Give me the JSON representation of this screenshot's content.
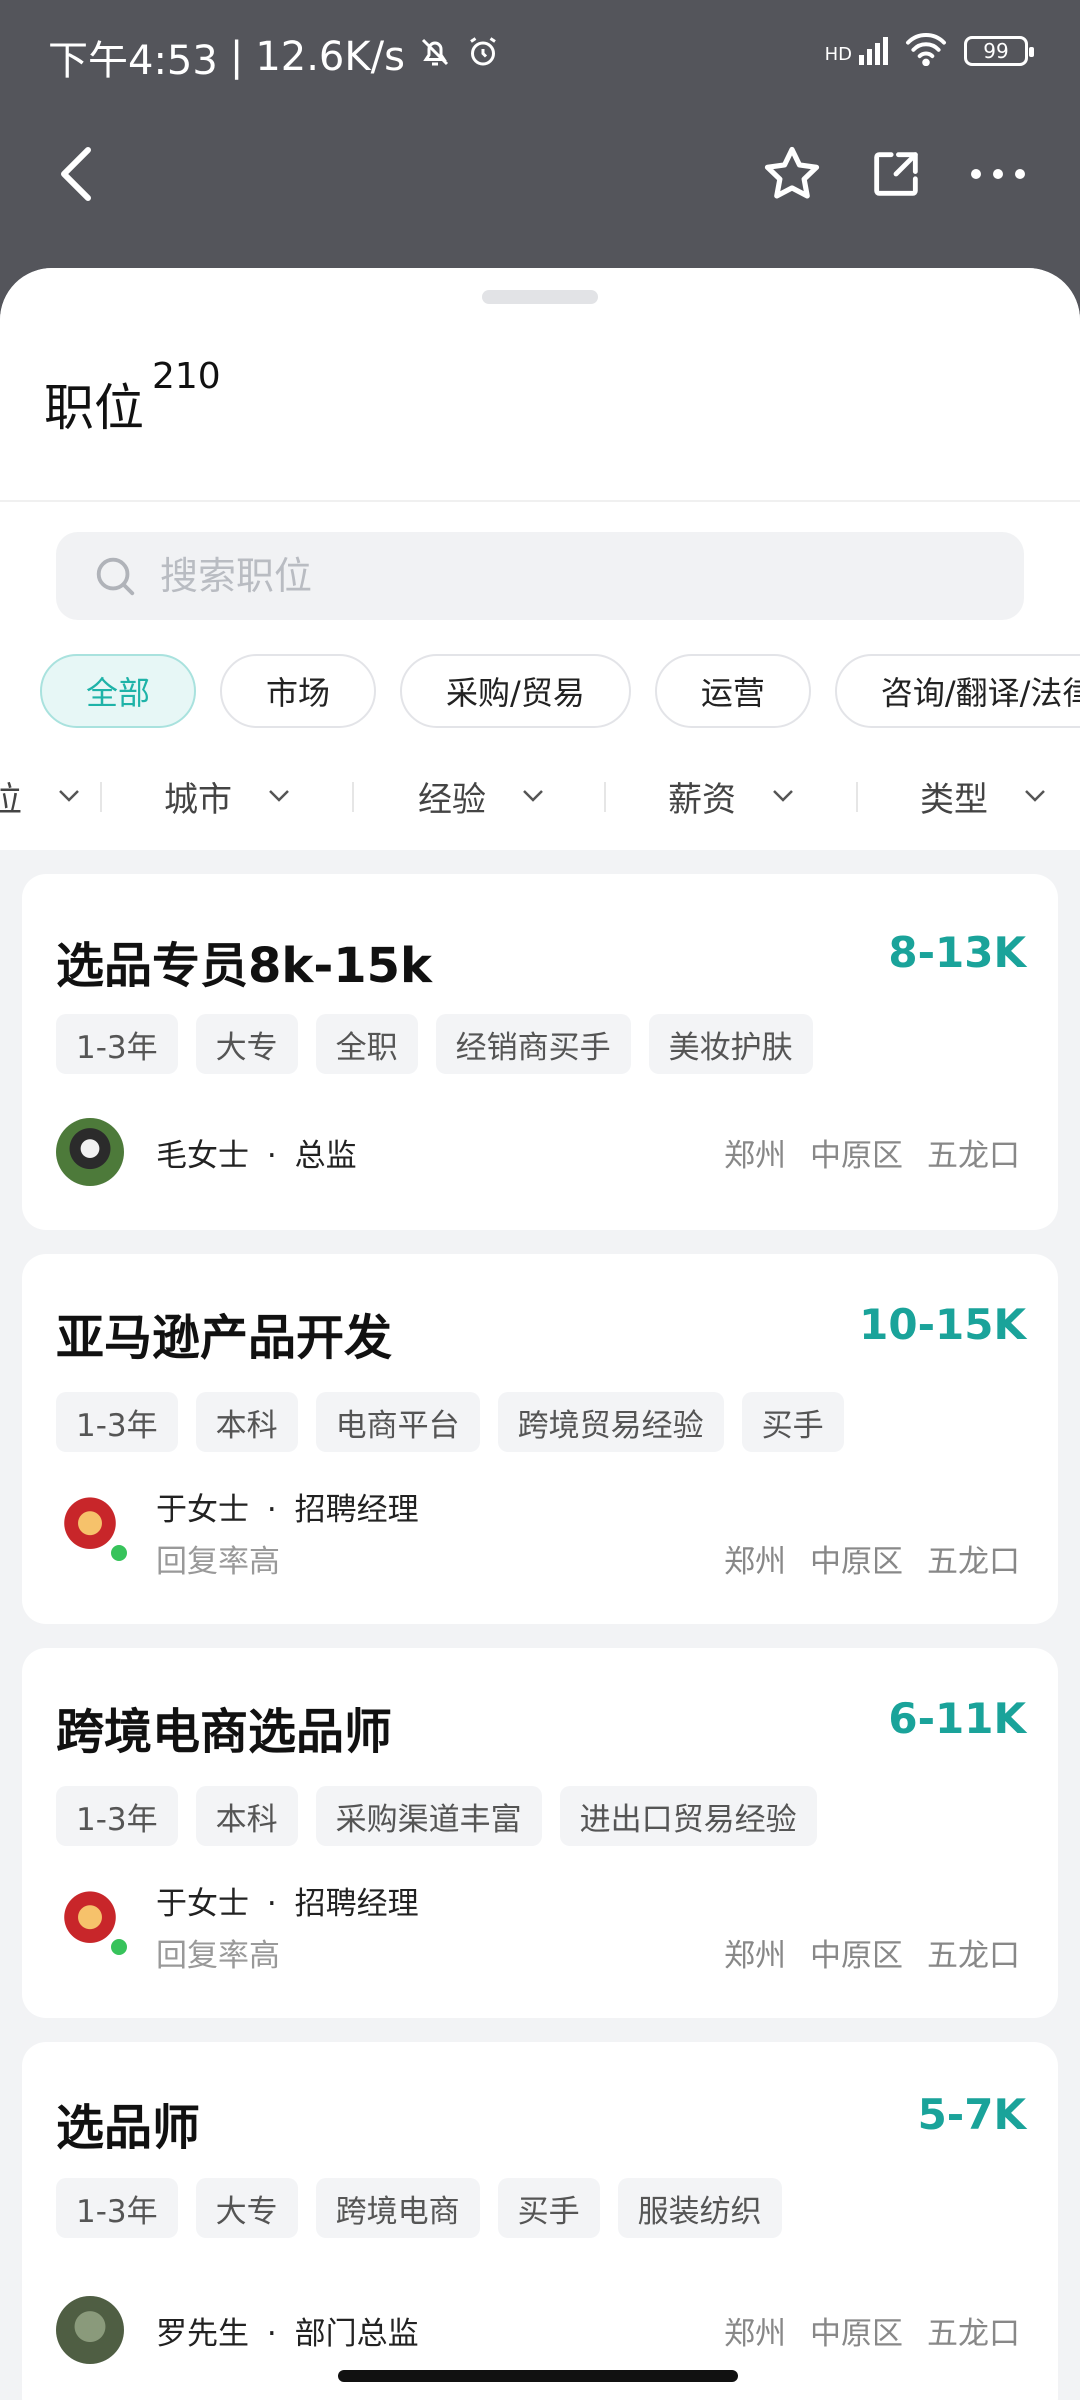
{
  "status": {
    "time": "下午4:53",
    "speed": "12.6K/s",
    "network": "HD",
    "battery": "99"
  },
  "header": {
    "title": "职位",
    "count": "210"
  },
  "search": {
    "placeholder": "搜索职位"
  },
  "chips": [
    "全部",
    "市场",
    "采购/贸易",
    "运营",
    "咨询/翻译/法律"
  ],
  "filters": [
    "职位",
    "城市",
    "经验",
    "薪资",
    "类型"
  ],
  "jobs": [
    {
      "title": "选品专员8k-15k",
      "salary": "8-13K",
      "tags": [
        "1-3年",
        "大专",
        "全职",
        "经销商买手",
        "美妆护肤"
      ],
      "recruiter": "毛女士",
      "role": "总监",
      "sub": "",
      "city": "郑州",
      "district": "中原区",
      "area": "五龙口"
    },
    {
      "title": "亚马逊产品开发",
      "salary": "10-15K",
      "tags": [
        "1-3年",
        "本科",
        "电商平台",
        "跨境贸易经验",
        "买手"
      ],
      "recruiter": "于女士",
      "role": "招聘经理",
      "sub": "回复率高",
      "city": "郑州",
      "district": "中原区",
      "area": "五龙口"
    },
    {
      "title": "跨境电商选品师",
      "salary": "6-11K",
      "tags": [
        "1-3年",
        "本科",
        "采购渠道丰富",
        "进出口贸易经验"
      ],
      "recruiter": "于女士",
      "role": "招聘经理",
      "sub": "回复率高",
      "city": "郑州",
      "district": "中原区",
      "area": "五龙口"
    },
    {
      "title": "选品师",
      "salary": "5-7K",
      "tags": [
        "1-3年",
        "大专",
        "跨境电商",
        "买手",
        "服装纺织"
      ],
      "recruiter": "罗先生",
      "role": "部门总监",
      "sub": "",
      "city": "郑州",
      "district": "中原区",
      "area": "五龙口"
    }
  ],
  "colors": {
    "accent": "#1aa39a",
    "header_bg": "#54555b",
    "online": "#37c35b"
  },
  "separator": "·"
}
